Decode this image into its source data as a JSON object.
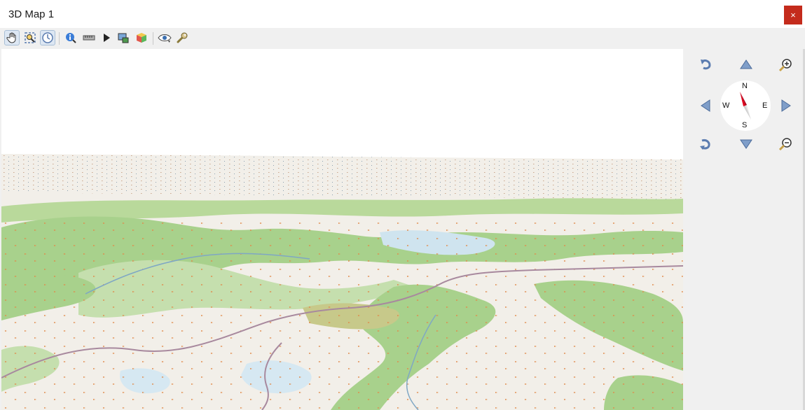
{
  "window": {
    "title": "3D Map 1",
    "close_label": "×"
  },
  "toolbar": {
    "buttons": [
      {
        "name": "pan-tool-button",
        "icon": "hand-icon",
        "active": true
      },
      {
        "name": "zoom-extent-button",
        "icon": "zoom-full-icon",
        "active": false
      },
      {
        "name": "camera-control-button",
        "icon": "camera-orbit-icon",
        "active": true
      },
      {
        "name": "identify-button",
        "icon": "identify-icon",
        "active": false
      },
      {
        "name": "measure-button",
        "icon": "ruler-icon",
        "active": false
      },
      {
        "name": "animation-button",
        "icon": "play-icon",
        "active": false
      },
      {
        "name": "save-image-button",
        "icon": "export-image-icon",
        "active": false
      },
      {
        "name": "export-scene-button",
        "icon": "3d-cube-icon",
        "active": false
      },
      {
        "name": "camera-view-button",
        "icon": "eye-icon",
        "active": false
      },
      {
        "name": "configure-button",
        "icon": "wrench-icon",
        "active": false
      }
    ]
  },
  "navigation": {
    "compass": {
      "north": "N",
      "south": "S",
      "east": "E",
      "west": "W"
    },
    "controls": [
      "rotate-ccw-icon",
      "tilt-up-icon",
      "zoom-in-icon",
      "pan-left-icon",
      "pan-right-icon",
      "rotate-cw-icon",
      "tilt-down-icon",
      "zoom-out-icon"
    ]
  },
  "colors": {
    "terrain_base": "#f2efe9",
    "forest": "#a8d18c",
    "scrub": "#c9dcaa",
    "water": "#cfe4ef",
    "road": "#9a7a90",
    "sky": "#ffffff",
    "accent": "#5b7cb0",
    "compass_needle": "#e0001b"
  }
}
